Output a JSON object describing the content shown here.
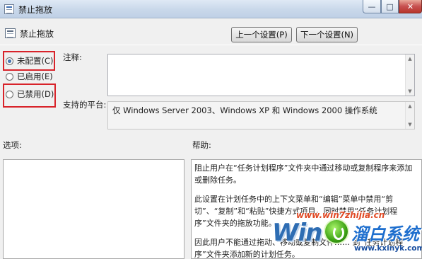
{
  "window": {
    "title": "禁止拖放",
    "icon": "policy-setting-icon",
    "controls": [
      "minimize-icon",
      "maximize-icon",
      "close-icon"
    ],
    "controls_glyphs": {
      "minimize": "—",
      "maximize": "□",
      "close": "✕"
    }
  },
  "header": {
    "setting_name": "禁止拖放",
    "prev_button": "上一个设置(P)",
    "next_button": "下一个设置(N)"
  },
  "state": {
    "options": [
      {
        "label": "未配置(C)",
        "checked": true
      },
      {
        "label": "已启用(E)",
        "checked": false
      },
      {
        "label": "已禁用(D)",
        "checked": false
      }
    ],
    "highlight_color": "#d8232a"
  },
  "labels": {
    "comment": "注释:",
    "platform": "支持的平台:",
    "options": "选项:",
    "help": "帮助:"
  },
  "comment_value": "",
  "platform_value": "仅 Windows Server 2003、Windows XP 和 Windows 2000 操作系统",
  "help": {
    "paragraphs": [
      "阻止用户在“任务计划程序”文件夹中通过移动或复制程序来添加或删除任务。",
      "此设置在计划任务中的上下文菜单和“编辑”菜单中禁用“剪切”、“复制”和“粘贴”快捷方式项目，同时禁用“任务计划程序”文件夹的拖放功能。",
      "因此用户不能通过拖动、移动或复制文件…… 到“任务计划程序”文件夹添加新的计划任务。"
    ]
  },
  "watermark": {
    "site": "www.win7zhijia.cn",
    "win_text": "Win",
    "brand": "溜白系统",
    "url": "www.kxinyk.com"
  }
}
